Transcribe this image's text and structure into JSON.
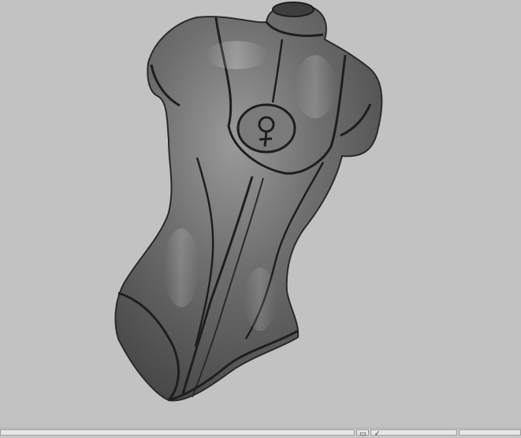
{
  "viewport": {
    "background": "#c2c2c2",
    "model": {
      "name": "torso-bodysuit-sculpt",
      "surface_color": "#6b6b6b",
      "seam_color": "#1e1e1e",
      "emblem_symbol": "female-symbol"
    }
  },
  "statusbar": {
    "icons": [
      "window-icon",
      "checkmark-icon"
    ]
  }
}
